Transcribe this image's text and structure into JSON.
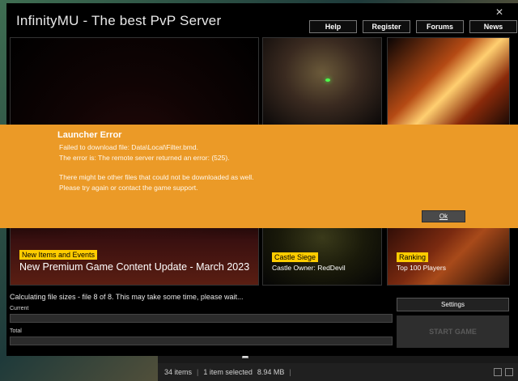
{
  "window": {
    "title": "InfinityMU - The best PvP Server",
    "close_glyph": "✕"
  },
  "nav": {
    "items": [
      {
        "label": "Help"
      },
      {
        "label": "Register"
      },
      {
        "label": "Forums"
      },
      {
        "label": "News"
      }
    ]
  },
  "news": {
    "main": {
      "tag": "New Items and Events",
      "headline": "New Premium Game Content Update - March 2023"
    },
    "castle": {
      "tag": "Castle Siege",
      "caption": "Castle Owner: RedDevil"
    },
    "ranking": {
      "tag": "Ranking",
      "caption": "Top 100 Players"
    }
  },
  "progress": {
    "status": "Calculating file sizes - file 8 of 8. This may take some time, please wait...",
    "current_label": "Current",
    "total_label": "Total",
    "current_fraction": 0,
    "total_fraction": 0
  },
  "buttons": {
    "settings": "Settings",
    "start": "START GAME"
  },
  "error": {
    "title": "Launcher Error",
    "lines": [
      "Failed to download file: Data\\Local\\Filter.bmd.",
      "The error is: The remote server returned an error: (525).",
      "",
      "There might be other files that could not be downloaded as well.",
      "Please try again or contact the game support."
    ],
    "ok": "Ok"
  },
  "explorer": {
    "item_count": "34 items",
    "selection": "1 item selected",
    "size": "8.94 MB"
  },
  "colors": {
    "error_bg": "#eb9a27",
    "tag_bg": "#ffcc00",
    "launcher_bg": "#000000"
  },
  "icons": [
    "close-icon",
    "file-icon",
    "details-view-icon",
    "tiles-view-icon"
  ]
}
